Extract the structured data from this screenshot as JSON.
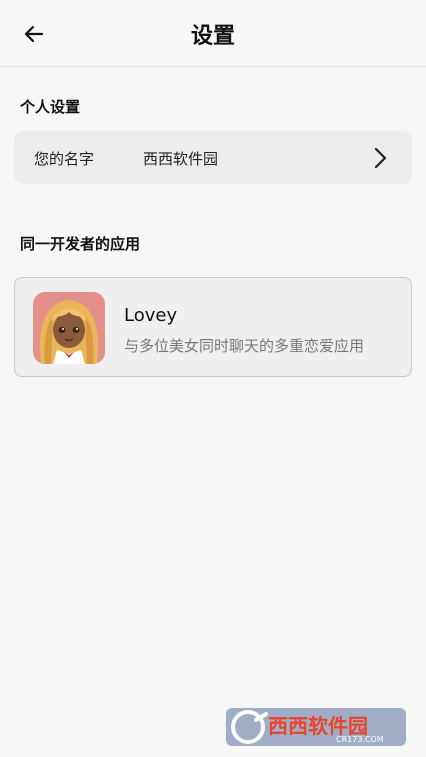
{
  "header": {
    "title": "设置"
  },
  "personal_section": {
    "title": "个人设置",
    "name_label": "您的名字",
    "name_value": "西西软件园"
  },
  "apps_section": {
    "title": "同一开发者的应用",
    "apps": [
      {
        "name": "Lovey",
        "description": "与多位美女同时聊天的多重恋爱应用",
        "icon": "anime-girl-avatar"
      }
    ]
  },
  "watermark": {
    "brand": "西西软件园",
    "domain": "CR173.COM"
  },
  "colors": {
    "background": "#f7f7f7",
    "card": "#ececec",
    "desc_text": "#7a7a7a"
  }
}
